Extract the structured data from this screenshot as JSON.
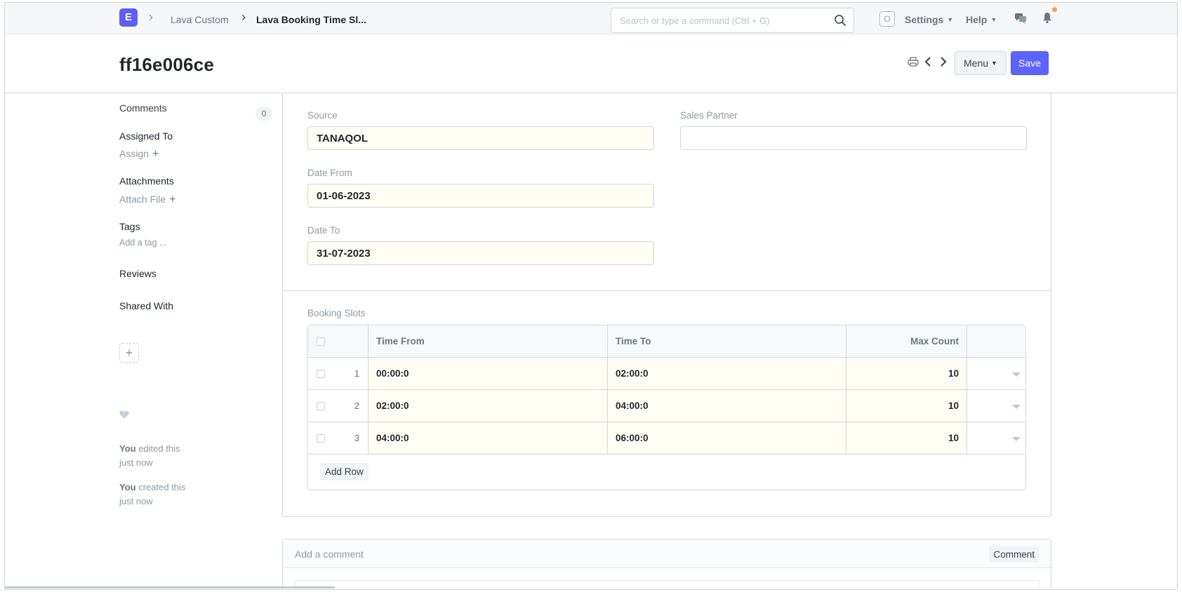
{
  "navbar": {
    "logo_letter": "E",
    "breadcrumbs": [
      "Lava Custom",
      "Lava Booking Time Sl..."
    ],
    "search_placeholder": "Search or type a command (Ctrl + G)",
    "avatar_letter": "O",
    "settings_label": "Settings",
    "help_label": "Help"
  },
  "page": {
    "title": "ff16e006ce",
    "menu_label": "Menu",
    "save_label": "Save"
  },
  "sidebar": {
    "comments_label": "Comments",
    "comments_count": "0",
    "assigned_to_label": "Assigned To",
    "assign_label": "Assign",
    "attachments_label": "Attachments",
    "attach_file_label": "Attach File",
    "tags_label": "Tags",
    "add_tag_label": "Add a tag ...",
    "reviews_label": "Reviews",
    "shared_with_label": "Shared With",
    "timeline": [
      {
        "actor": "You",
        "action": " edited this",
        "time": "just now"
      },
      {
        "actor": "You",
        "action": " created this",
        "time": "just now"
      }
    ]
  },
  "form": {
    "source_label": "Source",
    "source_value": "TANAQOL",
    "sales_partner_label": "Sales Partner",
    "sales_partner_value": "",
    "date_from_label": "Date From",
    "date_from_value": "01-06-2023",
    "date_to_label": "Date To",
    "date_to_value": "31-07-2023",
    "booking_slots_label": "Booking Slots"
  },
  "grid": {
    "columns": [
      "Time From",
      "Time To",
      "Max Count"
    ],
    "rows": [
      {
        "idx": "1",
        "time_from": "00:00:0",
        "time_to": "02:00:0",
        "max_count": "10"
      },
      {
        "idx": "2",
        "time_from": "02:00:0",
        "time_to": "04:00:0",
        "max_count": "10"
      },
      {
        "idx": "3",
        "time_from": "04:00:0",
        "time_to": "06:00:0",
        "max_count": "10"
      }
    ],
    "add_row_label": "Add Row"
  },
  "comment": {
    "title": "Add a comment",
    "button_label": "Comment"
  },
  "colors": {
    "accent": "#5e64ff",
    "logo": "#5f5df2",
    "notification_dot": "#ff9f43",
    "filled_input_bg": "#fffdf4"
  },
  "icons": [
    "search-icon",
    "print-icon",
    "chevron-left-icon",
    "chevron-right-icon",
    "chat-icon",
    "bell-icon",
    "heart-icon",
    "plus-icon"
  ]
}
